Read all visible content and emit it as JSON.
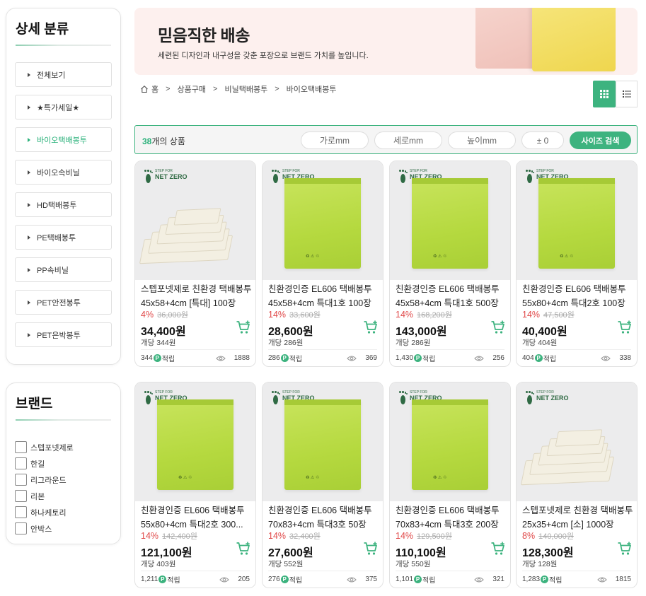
{
  "sidebar": {
    "category_title": "상세 분류",
    "categories": [
      {
        "label": "전체보기",
        "active": false
      },
      {
        "label": "★특가세일★",
        "active": false
      },
      {
        "label": "바이오택배봉투",
        "active": true
      },
      {
        "label": "바이오속비닐",
        "active": false
      },
      {
        "label": "HD택배봉투",
        "active": false
      },
      {
        "label": "PE택배봉투",
        "active": false
      },
      {
        "label": "PP속비닐",
        "active": false
      },
      {
        "label": "PET안전봉투",
        "active": false
      },
      {
        "label": "PET은박봉투",
        "active": false
      }
    ],
    "brand_title": "브랜드",
    "brands": [
      "스텝포넷제로",
      "한길",
      "리그라운드",
      "리본",
      "하나케토리",
      "안박스"
    ]
  },
  "banner": {
    "title": "믿음직한 배송",
    "subtitle": "세련된 디자인과 내구성을 갖춘 포장으로 브랜드 가치를 높입니다."
  },
  "breadcrumb": [
    "홈",
    "상품구매",
    "비닐택배봉투",
    "바이오택배봉투"
  ],
  "filter": {
    "count": "38",
    "count_suffix": "개의 상품",
    "width_placeholder": "가로mm",
    "length_placeholder": "세로mm",
    "height_placeholder": "높이mm",
    "tolerance": "± 0",
    "search_label": "사이즈 검색"
  },
  "logo": {
    "small": "STEP FOR",
    "big": "NET ZERO"
  },
  "products": [
    {
      "name": "스텝포넷제로 친환경 택배봉투 45x58+4cm [특대] 100장",
      "discount": "4%",
      "old_price": "36,000원",
      "price": "34,400원",
      "unit": "개당 344원",
      "points": "344",
      "points_label": "적립",
      "views": "1888",
      "image": "white-stack"
    },
    {
      "name": "친환경인증 EL606 택배봉투 45x58+4cm 특대1호 100장",
      "discount": "14%",
      "old_price": "33,600원",
      "price": "28,600원",
      "unit": "개당 286원",
      "points": "286",
      "points_label": "적립",
      "views": "369",
      "image": "green-bag"
    },
    {
      "name": "친환경인증 EL606 택배봉투 45x58+4cm 특대1호 500장",
      "discount": "14%",
      "old_price": "168,200원",
      "price": "143,000원",
      "unit": "개당 286원",
      "points": "1,430",
      "points_label": "적립",
      "views": "256",
      "image": "green-bag"
    },
    {
      "name": "친환경인증 EL606 택배봉투 55x80+4cm 특대2호 100장",
      "discount": "14%",
      "old_price": "47,500원",
      "price": "40,400원",
      "unit": "개당 404원",
      "points": "404",
      "points_label": "적립",
      "views": "338",
      "image": "green-bag"
    },
    {
      "name": "친환경인증 EL606 택배봉투 55x80+4cm 특대2호 300...",
      "discount": "14%",
      "old_price": "142,400원",
      "price": "121,100원",
      "unit": "개당 403원",
      "points": "1,211",
      "points_label": "적립",
      "views": "205",
      "image": "green-bag"
    },
    {
      "name": "친환경인증 EL606 택배봉투 70x83+4cm 특대3호 50장",
      "discount": "14%",
      "old_price": "32,400원",
      "price": "27,600원",
      "unit": "개당 552원",
      "points": "276",
      "points_label": "적립",
      "views": "375",
      "image": "green-bag"
    },
    {
      "name": "친환경인증 EL606 택배봉투 70x83+4cm 특대3호 200장",
      "discount": "14%",
      "old_price": "129,500원",
      "price": "110,100원",
      "unit": "개당 550원",
      "points": "1,101",
      "points_label": "적립",
      "views": "321",
      "image": "green-bag"
    },
    {
      "name": "스텝포넷제로 친환경 택배봉투 25x35+4cm [소] 1000장",
      "discount": "8%",
      "old_price": "140,000원",
      "price": "128,300원",
      "unit": "개당 128원",
      "points": "1,283",
      "points_label": "적립",
      "views": "1815",
      "image": "white-stack"
    }
  ],
  "colors": {
    "accent": "#3db37f",
    "discount": "#e04848",
    "banner_bg": "#fdf0ee"
  }
}
